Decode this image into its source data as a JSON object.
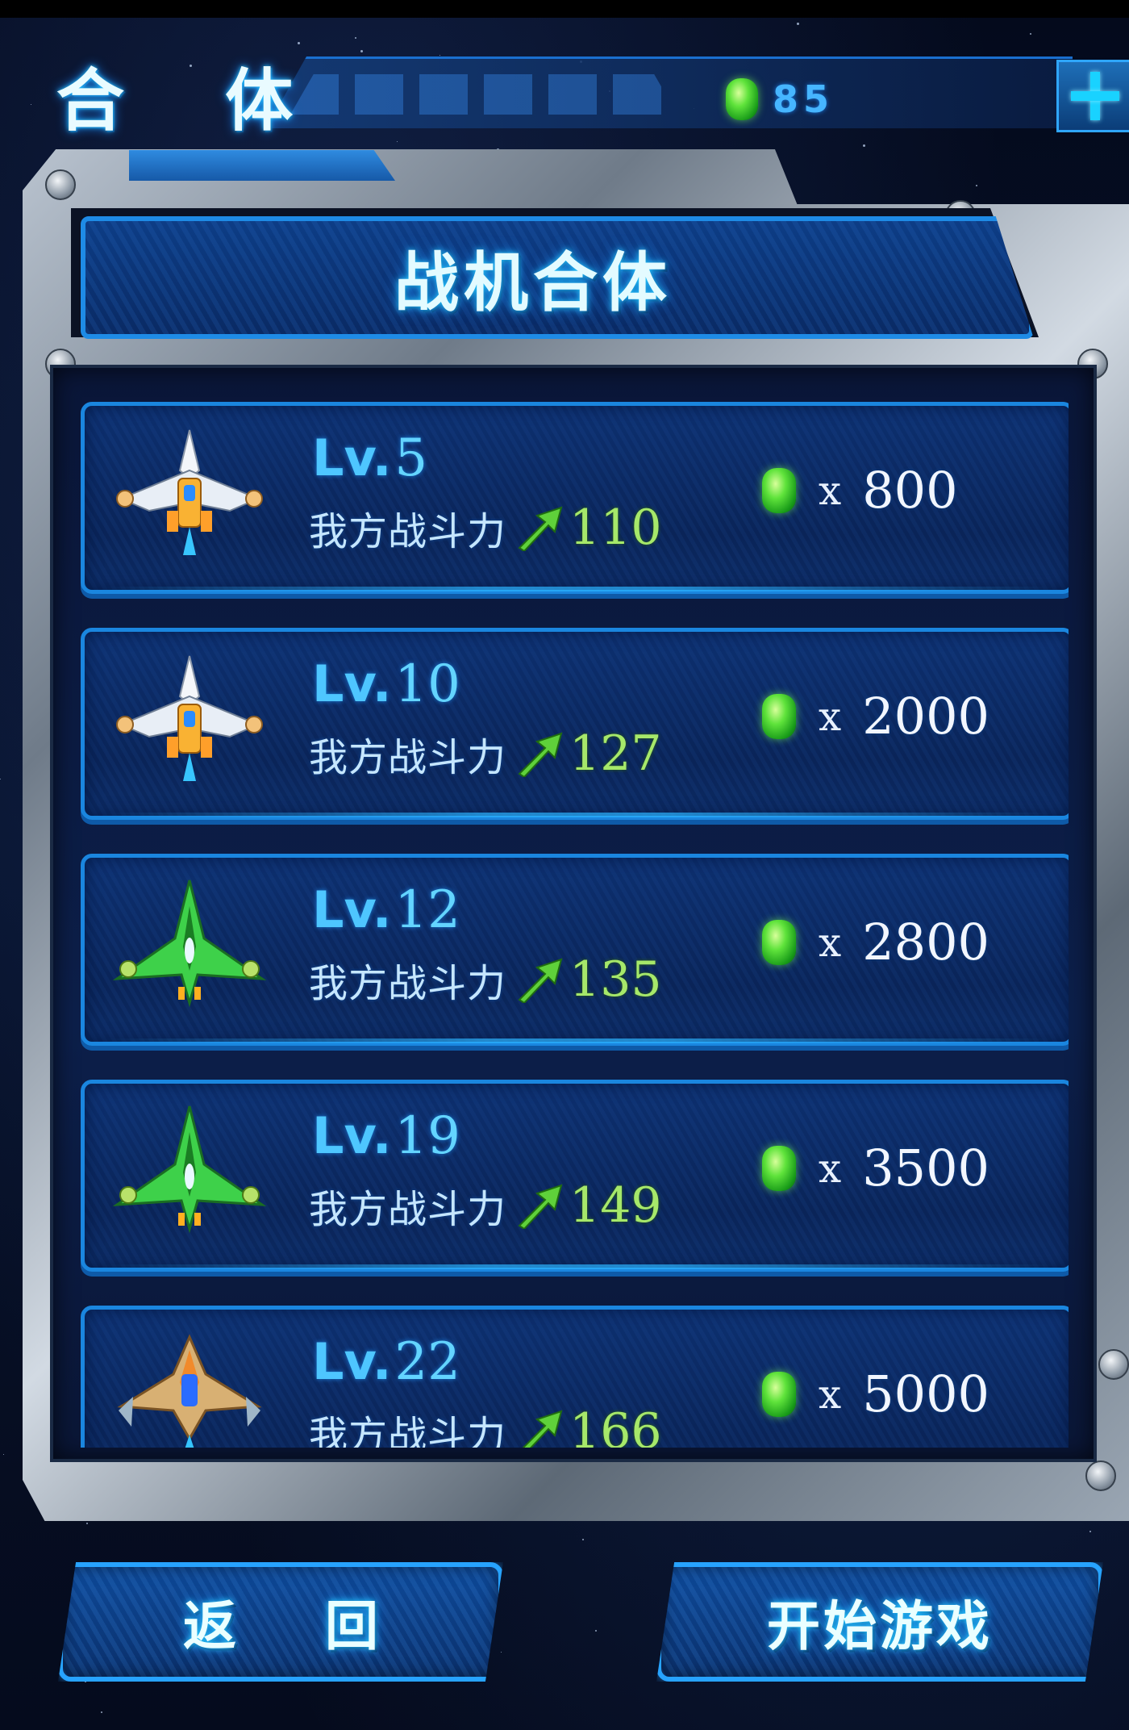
{
  "header": {
    "title": "合 体",
    "currency_value": "85",
    "currency_icon": "green-gem-icon",
    "add_icon": "plus-icon"
  },
  "panel": {
    "title": "战机合体"
  },
  "list": {
    "power_label": "我方战斗力",
    "cost_multiplier": "x",
    "items": [
      {
        "lv_prefix": "Lv.",
        "level": "5",
        "power": "110",
        "cost": "800",
        "ship_icon": "silver-fighter-icon"
      },
      {
        "lv_prefix": "Lv.",
        "level": "10",
        "power": "127",
        "cost": "2000",
        "ship_icon": "silver-fighter-icon"
      },
      {
        "lv_prefix": "Lv.",
        "level": "12",
        "power": "135",
        "cost": "2800",
        "ship_icon": "green-fighter-icon"
      },
      {
        "lv_prefix": "Lv.",
        "level": "19",
        "power": "149",
        "cost": "3500",
        "ship_icon": "green-fighter-icon"
      },
      {
        "lv_prefix": "Lv.",
        "level": "22",
        "power": "166",
        "cost": "5000",
        "ship_icon": "gold-fighter-icon"
      }
    ]
  },
  "buttons": {
    "back": "返回",
    "start": "开始游戏"
  },
  "colors": {
    "accent_blue": "#1a86df",
    "power_green": "#a6e86a",
    "level_cyan": "#4ec6ff"
  }
}
